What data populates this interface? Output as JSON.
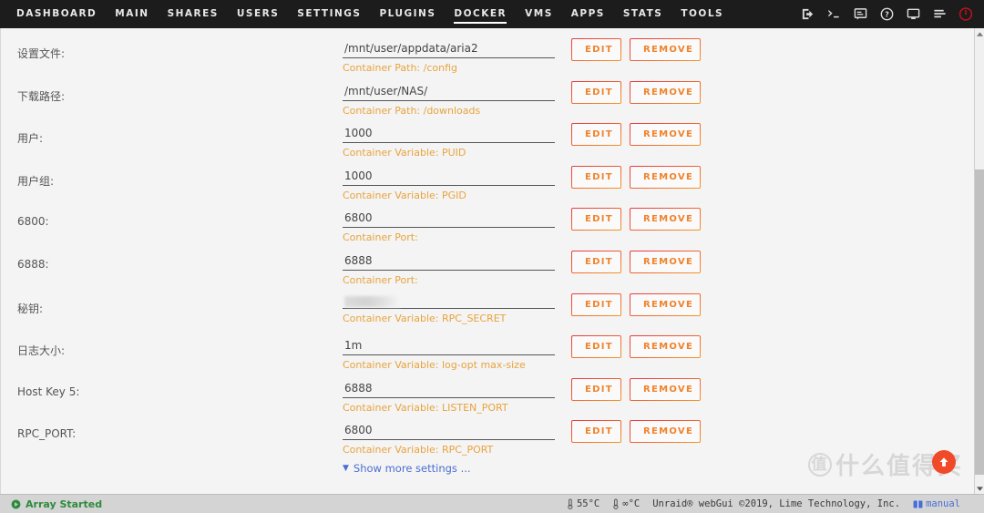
{
  "nav": {
    "items": [
      {
        "label": "DASHBOARD",
        "active": false
      },
      {
        "label": "MAIN",
        "active": false
      },
      {
        "label": "SHARES",
        "active": false
      },
      {
        "label": "USERS",
        "active": false
      },
      {
        "label": "SETTINGS",
        "active": false
      },
      {
        "label": "PLUGINS",
        "active": false
      },
      {
        "label": "DOCKER",
        "active": true
      },
      {
        "label": "VMS",
        "active": false
      },
      {
        "label": "APPS",
        "active": false
      },
      {
        "label": "STATS",
        "active": false
      },
      {
        "label": "TOOLS",
        "active": false
      }
    ],
    "icons": [
      {
        "name": "logout-icon"
      },
      {
        "name": "terminal-icon"
      },
      {
        "name": "chat-icon"
      },
      {
        "name": "help-icon"
      },
      {
        "name": "display-icon"
      },
      {
        "name": "log-icon"
      },
      {
        "name": "power-icon"
      }
    ]
  },
  "form": {
    "edit_label": "EDIT",
    "remove_label": "REMOVE",
    "rows": [
      {
        "label": "设置文件:",
        "value": "/mnt/user/appdata/aria2",
        "hint": "Container Path: /config",
        "redacted": false
      },
      {
        "label": "下载路径:",
        "value": "/mnt/user/NAS/",
        "hint": "Container Path: /downloads",
        "redacted": false
      },
      {
        "label": "用户:",
        "value": "1000",
        "hint": "Container Variable: PUID",
        "redacted": false
      },
      {
        "label": "用户组:",
        "value": "1000",
        "hint": "Container Variable: PGID",
        "redacted": false
      },
      {
        "label": "6800:",
        "value": "6800",
        "hint": "Container Port:",
        "redacted": false
      },
      {
        "label": "6888:",
        "value": "6888",
        "hint": "Container Port:",
        "redacted": false
      },
      {
        "label": "秘钥:",
        "value": "",
        "hint": "Container Variable: RPC_SECRET",
        "redacted": true
      },
      {
        "label": "日志大小:",
        "value": "1m",
        "hint": "Container Variable: log-opt max-size",
        "redacted": false
      },
      {
        "label": "Host Key 5:",
        "value": "6888",
        "hint": "Container Variable: LISTEN_PORT",
        "redacted": false
      },
      {
        "label": "RPC_PORT:",
        "value": "6800",
        "hint": "Container Variable: RPC_PORT",
        "redacted": false
      }
    ],
    "show_more_label": "Show more settings ...",
    "show_more_chevron": "chevron-down-icon"
  },
  "footer": {
    "array_status": "Array Started",
    "cpu_temp": "55°C",
    "board_temp": "∞°C",
    "copyright": "Unraid® webGui ©2019, Lime Technology, Inc.",
    "manual_label": "manual"
  },
  "watermark": {
    "mark": "值",
    "text": "什么值得买"
  },
  "colors": {
    "nav_bg": "#1c1c1c",
    "accent_orange": "#f0832c",
    "hint_orange": "#e8a33d",
    "link_blue": "#4a6fd4",
    "status_green": "#2e8b3d",
    "power_red": "#b5111e"
  }
}
